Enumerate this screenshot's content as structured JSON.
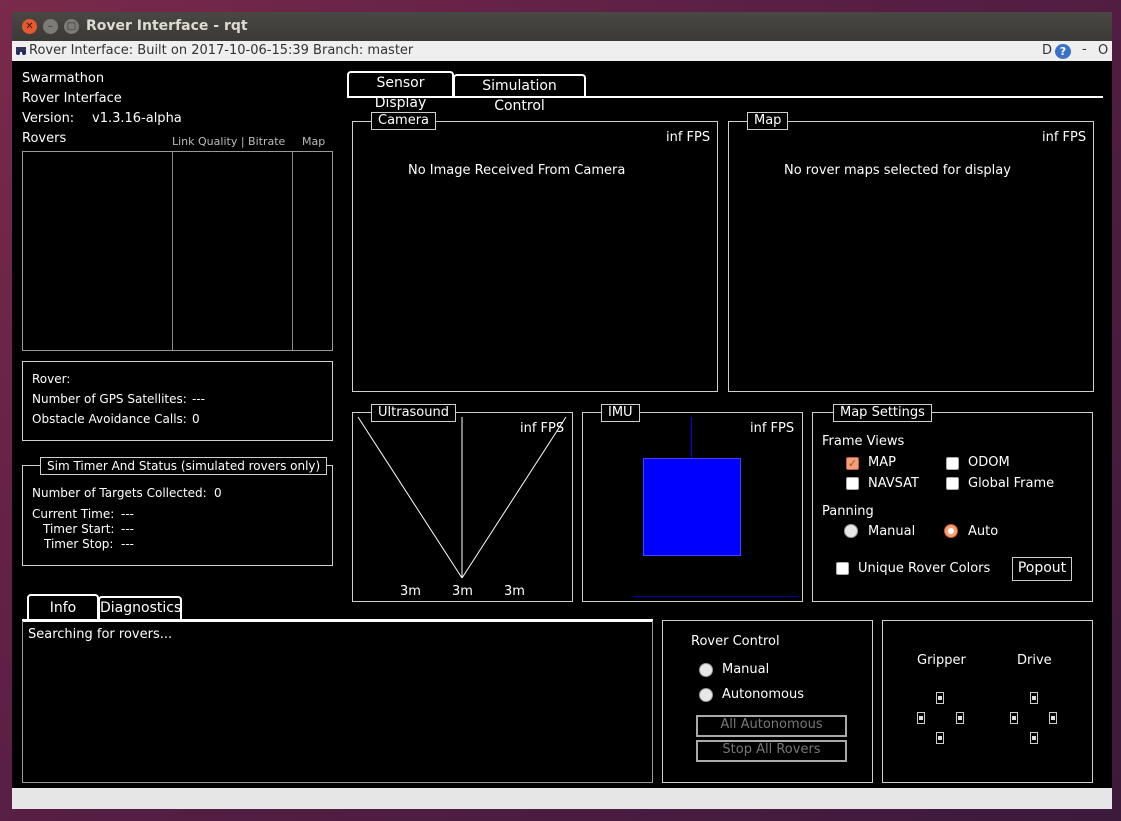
{
  "window": {
    "title": "Rover Interface - rqt",
    "plugin_title": "Rover Interface: Built on 2017-10-06-15:39 Branch: master",
    "plugin_buttons": [
      "D",
      "?",
      "-",
      "O"
    ]
  },
  "left": {
    "app_name": "Swarmathon",
    "app_sub": "Rover Interface",
    "version_label": "Version:",
    "version_value": "v1.3.16-alpha",
    "rovers_label": "Rovers",
    "col_link": "Link Quality | Bitrate",
    "col_map": "Map"
  },
  "rover_info": {
    "rover": "Rover:",
    "gps_label": "Number of GPS Satellites:",
    "gps_value": "---",
    "obstacle_label": "Obstacle Avoidance Calls:",
    "obstacle_value": "0"
  },
  "sim_timer": {
    "title": "Sim Timer And Status (simulated rovers only)",
    "targets_label": "Number of Targets Collected:",
    "targets_value": "0",
    "current_label": "Current Time:",
    "current_value": "---",
    "start_label": "Timer Start:",
    "start_value": "---",
    "stop_label": "Timer Stop:",
    "stop_value": "---"
  },
  "tabs": {
    "sensor": "Sensor Display",
    "sim": "Simulation Control",
    "info": "Info",
    "diag": "Diagnostics"
  },
  "camera": {
    "title": "Camera",
    "fps": "inf FPS",
    "message": "No Image Received From Camera"
  },
  "map": {
    "title": "Map",
    "fps": "inf FPS",
    "message": "No rover maps selected for display"
  },
  "ultrasound": {
    "title": "Ultrasound",
    "fps": "inf FPS",
    "left": "3m",
    "center": "3m",
    "right": "3m"
  },
  "imu": {
    "title": "IMU",
    "fps": "inf FPS",
    "cube_color": "#0000ff"
  },
  "map_settings": {
    "title": "Map Settings",
    "frame_views": "Frame Views",
    "map": "MAP",
    "map_checked": true,
    "odom": "ODOM",
    "navsat": "NAVSAT",
    "global_frame": "Global Frame",
    "panning": "Panning",
    "manual": "Manual",
    "auto": "Auto",
    "panning_selected": "Auto",
    "unique_colors": "Unique Rover Colors",
    "popout": "Popout"
  },
  "info": {
    "text": "Searching for rovers..."
  },
  "rover_control": {
    "title": "Rover Control",
    "manual": "Manual",
    "autonomous": "Autonomous",
    "all_autonomous": "All Autonomous",
    "stop_all": "Stop All Rovers"
  },
  "joystick": {
    "gripper": "Gripper",
    "drive": "Drive"
  }
}
